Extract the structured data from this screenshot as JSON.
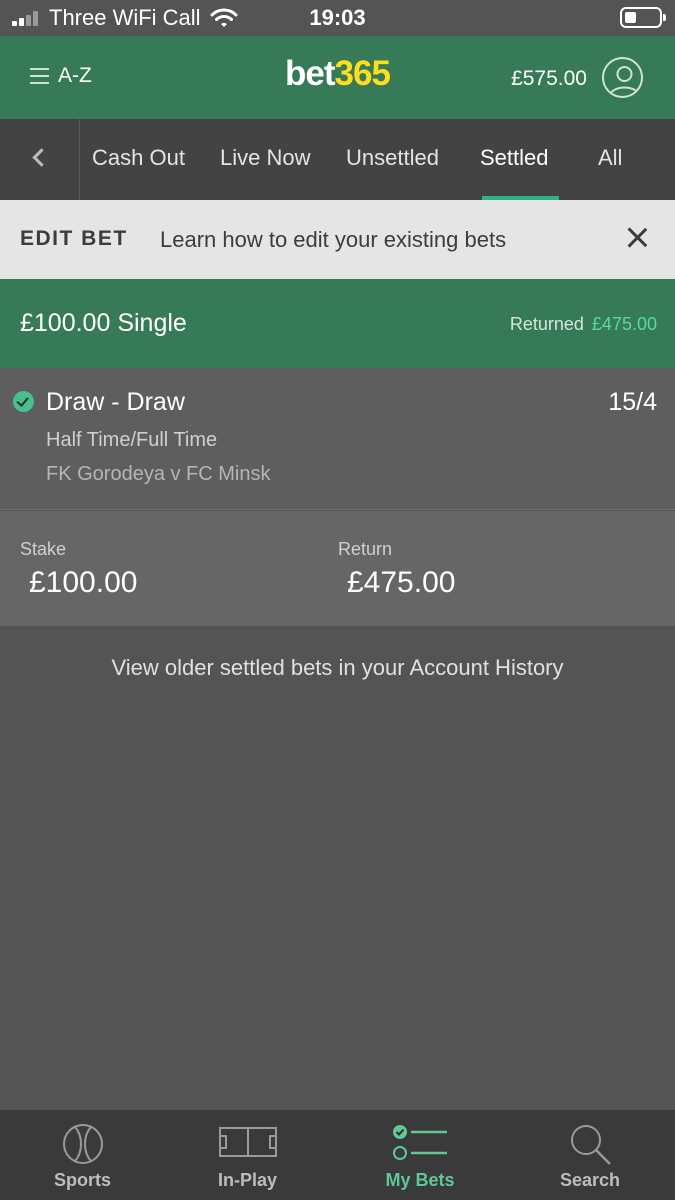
{
  "status_bar": {
    "carrier": "Three WiFi Call",
    "time": "19:03",
    "icons": [
      "signal-icon",
      "wifi-icon",
      "battery-icon"
    ]
  },
  "header": {
    "menu_label": "A-Z",
    "logo_part1": "bet",
    "logo_part2": "365",
    "balance": "£575.00",
    "icons": [
      "hamburger-icon",
      "account-icon"
    ],
    "colors": {
      "brand_green": "#367a57",
      "logo_yellow": "#ffdf1b"
    }
  },
  "tabs": {
    "items": [
      "Cash Out",
      "Live Now",
      "Unsettled",
      "Settled",
      "All"
    ],
    "active": "Settled",
    "accent": "#2eb383"
  },
  "edit_bet_banner": {
    "label": "EDIT BET",
    "text": "Learn how to edit your existing bets"
  },
  "bet": {
    "title": "£100.00 Single",
    "returned_label": "Returned",
    "returned_value": "£475.00",
    "selection": {
      "name": "Draw - Draw",
      "odds": "15/4",
      "market": "Half Time/Full Time",
      "event": "FK Gorodeya v FC Minsk",
      "status": "won"
    },
    "stake_label": "Stake",
    "stake_value": "£100.00",
    "return_label": "Return",
    "return_value": "£475.00"
  },
  "history_link": "View older settled bets in your Account History",
  "bottom_nav": {
    "items": [
      {
        "label": "Sports",
        "icon": "ball-icon"
      },
      {
        "label": "In-Play",
        "icon": "pitch-icon"
      },
      {
        "label": "My Bets",
        "icon": "my-bets-icon"
      },
      {
        "label": "Search",
        "icon": "search-icon"
      }
    ],
    "active": "My Bets"
  }
}
